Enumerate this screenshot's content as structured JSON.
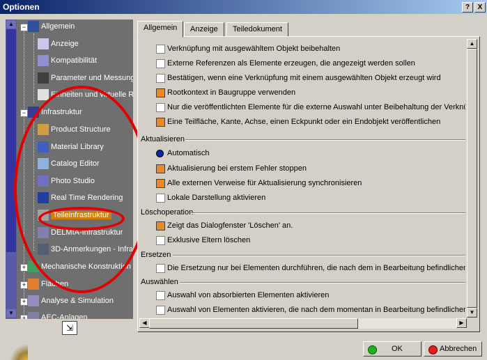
{
  "window": {
    "title": "Optionen",
    "help_label": "?",
    "close_label": "X"
  },
  "tree": {
    "nodes": [
      {
        "label": "Allgemein"
      },
      {
        "label": "Anzeige"
      },
      {
        "label": "Kompatibilität"
      },
      {
        "label": "Parameter und Messung"
      },
      {
        "label": "Einheiten und virtuelle Re"
      },
      {
        "label": "Infrastruktur"
      },
      {
        "label": "Product Structure"
      },
      {
        "label": "Material Library"
      },
      {
        "label": "Catalog Editor"
      },
      {
        "label": "Photo Studio"
      },
      {
        "label": "Real Time Rendering"
      },
      {
        "label": "Teileinfrastruktur"
      },
      {
        "label": "DELMIA-Infrastruktur"
      },
      {
        "label": "3D-Anmerkungen - Infra"
      },
      {
        "label": "Mechanische Konstruktion"
      },
      {
        "label": "Flächen"
      },
      {
        "label": "Analyse & Simulation"
      },
      {
        "label": "AEC-Anlagen"
      }
    ],
    "selected": "Teileinfrastruktur"
  },
  "tabs": [
    {
      "label": "Allgemein"
    },
    {
      "label": "Anzeige"
    },
    {
      "label": "Teiledokument"
    }
  ],
  "options": {
    "top": [
      {
        "label": "Verknüpfung mit ausgewähltem Objekt beibehalten",
        "checked": false
      },
      {
        "label": "Externe Referenzen als Elemente erzeugen, die angezeigt werden sollen",
        "checked": false
      },
      {
        "label": "Bestätigen, wenn eine Verknüpfung mit einem ausgewählten Objekt erzeugt wird",
        "checked": false
      },
      {
        "label": "Rootkontext in Baugruppe verwenden",
        "checked": true
      },
      {
        "label": "Nur die veröffentlichten Elemente für die externe Auswahl unter Beibehaltung der Verknüp",
        "checked": false
      },
      {
        "label": "Eine Teilfläche, Kante, Achse, einen Eckpunkt oder ein Endobjekt veröffentlichen",
        "checked": true
      }
    ],
    "aktualisieren": {
      "title": "Aktualisieren",
      "radio": "Automatisch",
      "items": [
        {
          "label": "Aktualisierung bei erstem Fehler stoppen",
          "checked": true
        },
        {
          "label": "Alle externen Verweise für Aktualisierung synchronisieren",
          "checked": true
        },
        {
          "label": "Lokale Darstellung aktivieren",
          "checked": false
        }
      ]
    },
    "loeschoperation": {
      "title": "Löschoperation",
      "items": [
        {
          "label": "Zeigt das Dialogfenster 'Löschen' an.",
          "checked": true
        },
        {
          "label": "Exklusive Eltern löschen",
          "checked": false
        }
      ]
    },
    "ersetzen": {
      "title": "Ersetzen",
      "items": [
        {
          "label": "Die Ersetzung nur bei Elementen durchführen, die nach dem in Bearbeitung befindlichen O",
          "checked": false
        }
      ]
    },
    "auswaehlen": {
      "title": "Auswählen",
      "items": [
        {
          "label": "Auswahl von absorbierten Elementen aktivieren",
          "checked": false
        },
        {
          "label": "Auswahl von Elementen aktivieren, die nach dem momentan in Bearbeitung befindlichen El",
          "checked": false
        }
      ]
    }
  },
  "buttons": {
    "ok": "OK",
    "cancel": "Abbrechen"
  },
  "colors": {
    "title_start": "#0a246a",
    "title_end": "#a6caf0",
    "tree_bg": "#6f6f6f",
    "selected": "#d08000",
    "checked": "#e88a2a",
    "annotation": "#e00000"
  }
}
